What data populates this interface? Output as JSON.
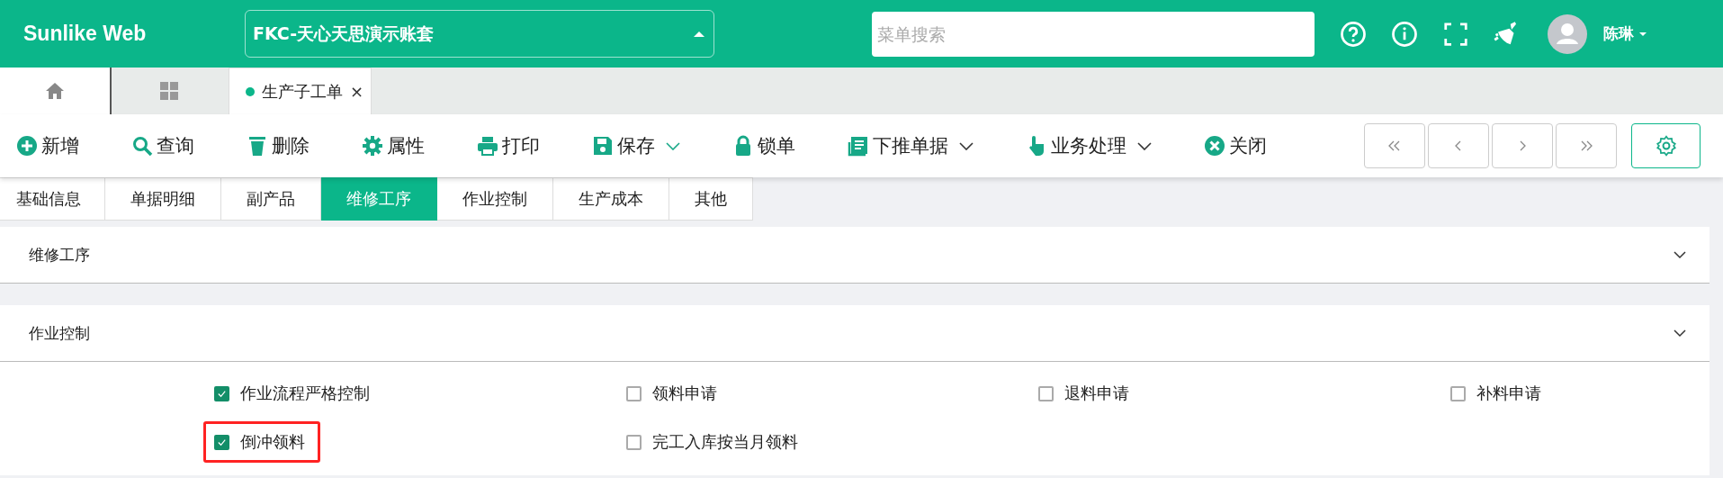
{
  "header": {
    "logo": "Sunlike Web",
    "account": "FKC-天心天思演示账套",
    "search": {
      "placeholder": "菜单搜索"
    },
    "user": "陈琳"
  },
  "page_tabs": [
    {
      "label": "生产子工单",
      "close": "×",
      "selected": true
    }
  ],
  "toolbar": [
    {
      "label": "新增",
      "kind": "plus",
      "dropdown": false
    },
    {
      "label": "查询",
      "kind": "search",
      "dropdown": false
    },
    {
      "label": "删除",
      "kind": "trash",
      "dropdown": false
    },
    {
      "label": "属性",
      "kind": "gear",
      "dropdown": false
    },
    {
      "label": "打印",
      "kind": "printer",
      "dropdown": false
    },
    {
      "label": "保存",
      "kind": "floppy",
      "dropdown": true
    },
    {
      "label": "锁单",
      "kind": "lock",
      "dropdown": false
    },
    {
      "label": "下推单据",
      "kind": "doc",
      "dropdown": true
    },
    {
      "label": "业务处理",
      "kind": "hand",
      "dropdown": true
    },
    {
      "label": "关闭",
      "kind": "close",
      "dropdown": false
    }
  ],
  "form_tabs": [
    {
      "label": "基础信息",
      "selected": false
    },
    {
      "label": "单据明细",
      "selected": false
    },
    {
      "label": "副产品",
      "selected": false
    },
    {
      "label": "维修工序",
      "selected": true
    },
    {
      "label": "作业控制",
      "selected": false
    },
    {
      "label": "生产成本",
      "selected": false
    },
    {
      "label": "其他",
      "selected": false
    }
  ],
  "sections": [
    {
      "title": "维修工序"
    },
    {
      "title": "作业控制",
      "checkboxes": [
        {
          "label": "作业流程严格控制",
          "checked": true,
          "highlighted": false
        },
        {
          "label": "领料申请",
          "checked": false,
          "highlighted": false
        },
        {
          "label": "退料申请",
          "checked": false,
          "highlighted": false
        },
        {
          "label": "补料申请",
          "checked": false,
          "highlighted": false
        },
        {
          "label": "倒冲领料",
          "checked": true,
          "highlighted": true
        },
        {
          "label": "完工入库按当月领料",
          "checked": false,
          "highlighted": false
        }
      ]
    }
  ]
}
